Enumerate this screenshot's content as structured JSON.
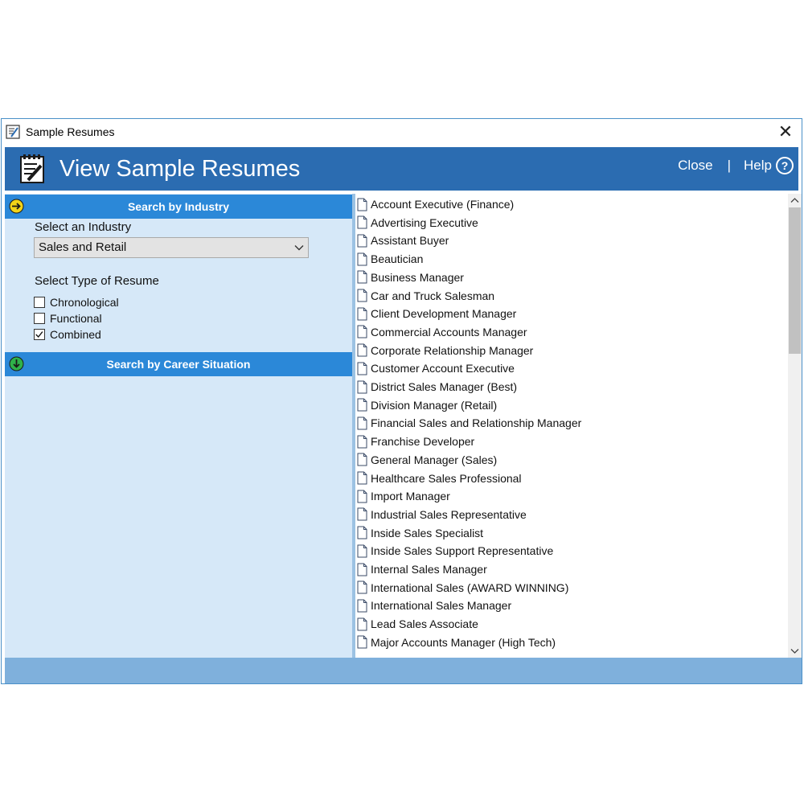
{
  "window": {
    "title": "Sample Resumes",
    "close_glyph": "✕"
  },
  "banner": {
    "title": "View Sample Resumes",
    "close_label": "Close",
    "separator": "|",
    "help_label": "Help",
    "help_glyph": "?"
  },
  "left_panel": {
    "industry_section": {
      "header": "Search by Industry",
      "select_label": "Select an Industry",
      "selected_industry": "Sales and Retail",
      "type_label": "Select Type of Resume",
      "types": [
        {
          "label": "Chronological",
          "checked": false
        },
        {
          "label": "Functional",
          "checked": false
        },
        {
          "label": "Combined",
          "checked": true
        }
      ]
    },
    "career_section": {
      "header": "Search by Career Situation"
    }
  },
  "resume_list": [
    "Account Executive (Finance)",
    "Advertising Executive",
    "Assistant Buyer",
    "Beautician",
    "Business Manager",
    "Car and Truck Salesman",
    "Client Development Manager",
    "Commercial Accounts Manager",
    "Corporate Relationship Manager",
    "Customer Account Executive",
    "District Sales Manager (Best)",
    "Division Manager (Retail)",
    "Financial Sales and Relationship Manager",
    "Franchise Developer",
    "General Manager (Sales)",
    "Healthcare Sales Professional",
    "Import Manager",
    "Industrial Sales Representative",
    "Inside Sales Specialist",
    "Inside Sales Support Representative",
    "Internal Sales Manager",
    "International Sales (AWARD WINNING)",
    "International Sales Manager",
    "Lead Sales Associate",
    "Major Accounts Manager (High Tech)"
  ],
  "colors": {
    "banner": "#2b6cb1",
    "section_header": "#2b88d8",
    "left_panel_bg": "#d6e8f8",
    "status_bar": "#7fb0dc",
    "industry_icon": "#f2d418",
    "career_icon": "#2fb24a"
  },
  "icons": {
    "app": "notepad-icon",
    "industry_section": "arrow-right-circle-icon",
    "career_section": "arrow-down-circle-icon",
    "list_item": "document-icon",
    "help": "question-circle-icon"
  }
}
